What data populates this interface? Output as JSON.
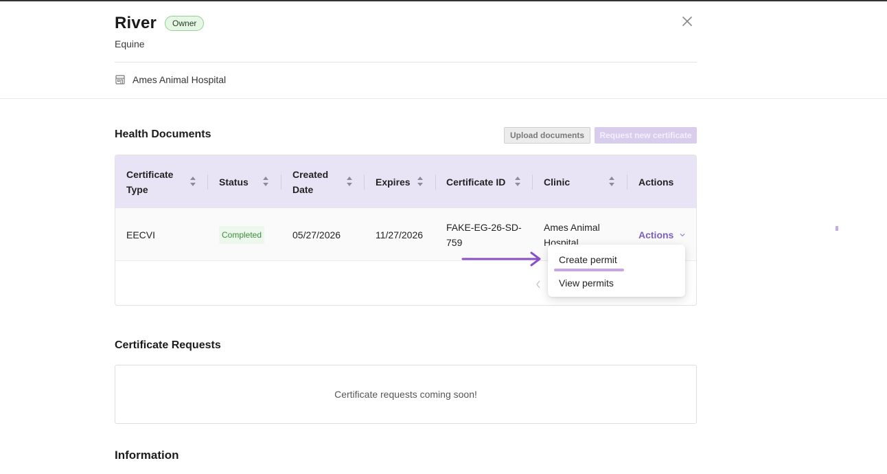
{
  "patient": {
    "name": "River",
    "role_badge": "Owner",
    "species": "Equine",
    "clinic": "Ames Animal Hospital"
  },
  "health_documents": {
    "title": "Health Documents",
    "upload_label": "Upload documents",
    "request_label": "Request new certificate",
    "columns": [
      "Certificate Type",
      "Status",
      "Created Date",
      "Expires",
      "Certificate ID",
      "Clinic",
      "Actions"
    ],
    "rows": [
      {
        "certificate_type": "EECVI",
        "status": "Completed",
        "created_date": "05/27/2026",
        "expires": "11/27/2026",
        "certificate_id": "FAKE-EG-26-SD-759",
        "clinic": "Ames Animal Hospital",
        "actions": "Actions"
      }
    ]
  },
  "actions_menu": {
    "items": [
      "Create permit",
      "View permits"
    ]
  },
  "certificate_requests": {
    "title": "Certificate Requests",
    "empty_message": "Certificate requests coming soon!"
  },
  "information": {
    "title": "Information"
  },
  "colors": {
    "accent": "#7b5fc1",
    "table_header_bg": "#e9e4f5",
    "status_green": "#3d8a3d",
    "annotation_arrow": "#8a4fc4",
    "annotation_underline": "#c9a3e6"
  },
  "icons": {
    "close": "close-icon",
    "clinic": "building-icon",
    "sort": "sort-icon",
    "chevron": "chevron-down-icon",
    "pager": "chevron-left-icon"
  }
}
